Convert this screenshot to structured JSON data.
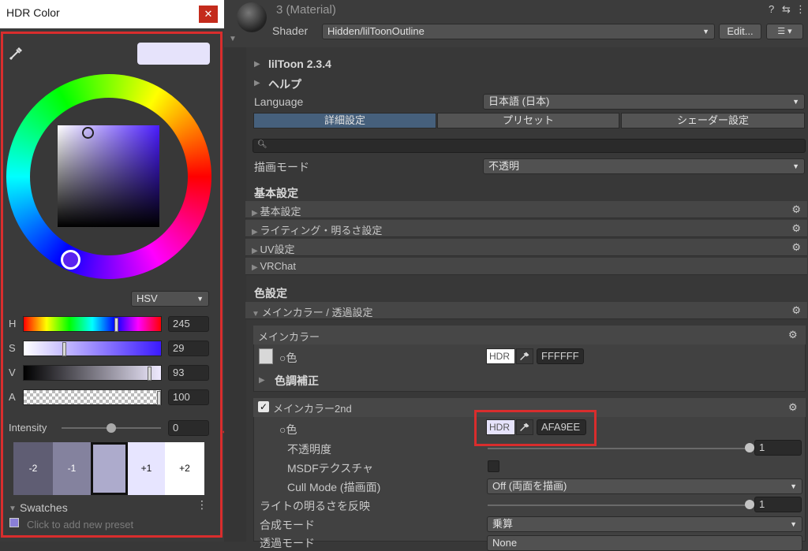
{
  "hdr_window": {
    "title": "HDR Color",
    "close": "✕",
    "mode": "HSV",
    "channels": [
      {
        "label": "H",
        "value": "245"
      },
      {
        "label": "S",
        "value": "29"
      },
      {
        "label": "V",
        "value": "93"
      },
      {
        "label": "A",
        "value": "100"
      }
    ],
    "channel_levels": {
      "H": 0.68,
      "S": 0.29,
      "V": 0.93,
      "A": 1.0
    },
    "intensity_label": "Intensity",
    "intensity_value": "0",
    "intensity_level": 0.5,
    "exposure_swatches": [
      "-2",
      "-1",
      "",
      "+1",
      "+2"
    ],
    "swatches_label": "Swatches",
    "add_preset": "Click to add new preset",
    "preview_color": "#E6E3FB"
  },
  "inspector": {
    "material_title": "3 (Material)",
    "shader_label": "Shader",
    "shader_value": "Hidden/lilToonOutline",
    "edit_button": "Edit...",
    "header_icons": [
      "?",
      "⇆",
      "⋮"
    ],
    "version": "lilToon 2.3.4",
    "help": "ヘルプ",
    "language_label": "Language",
    "language_value": "日本語 (日本)",
    "tabs": [
      "詳細設定",
      "プリセット",
      "シェーダー設定"
    ],
    "render_mode_label": "描画モード",
    "render_mode_value": "不透明",
    "basic_section": "基本設定",
    "basic_foldouts": [
      "基本設定",
      "ライティング・明るさ設定",
      "UV設定",
      "VRChat"
    ],
    "color_section": "色設定",
    "main_color_foldout": "メインカラー / 透過設定",
    "main_color": {
      "title": "メインカラー",
      "color_label": "色",
      "hdr": "HDR",
      "hex": "FFFFFF",
      "tone": "色調補正"
    },
    "main_color_2nd": {
      "title": "メインカラー2nd",
      "color_label": "色",
      "hdr": "HDR",
      "hex": "AFA9EE",
      "opacity_label": "不透明度",
      "opacity_value": "1",
      "opacity_level": 1.0,
      "msdf_label": "MSDFテクスチャ",
      "cull_label": "Cull Mode (描画面)",
      "cull_value": "Off (両面を描画)",
      "light_label": "ライトの明るさを反映",
      "light_value": "1",
      "light_level": 1.0,
      "blend_label": "合成モード",
      "blend_value": "乗算",
      "transparent_label": "透過モード",
      "transparent_value": "None"
    }
  },
  "colors": {
    "accent_red": "#D92D2D",
    "selected_tab": "#46607C",
    "main_color_2nd_hex": "#AFA9EE"
  }
}
